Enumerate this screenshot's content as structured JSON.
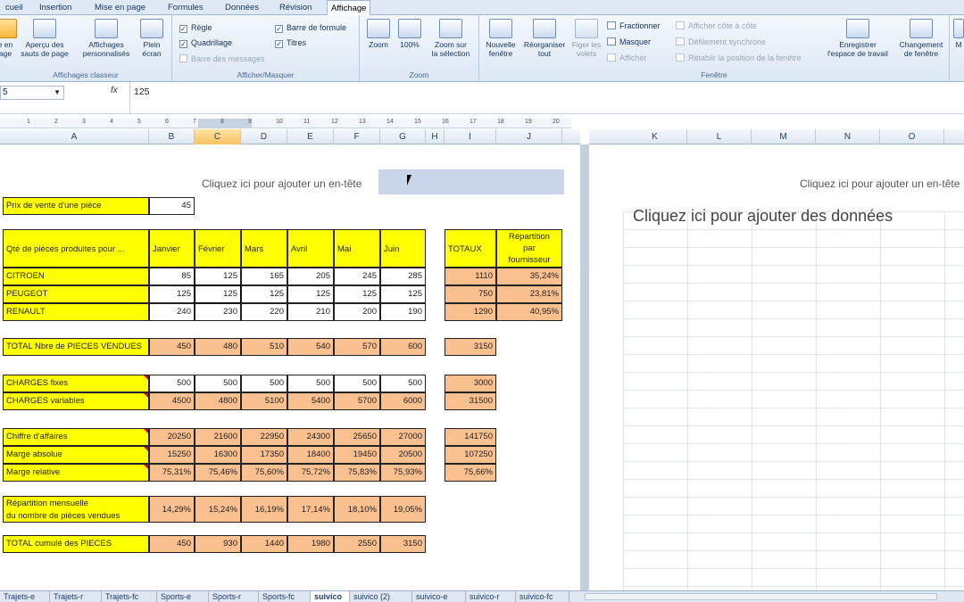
{
  "ribbon_tabs": [
    "cueil",
    "Insertion",
    "Mise en page",
    "Formules",
    "Données",
    "Révision",
    "Affichage"
  ],
  "active_tab": "Affichage",
  "ribbon": {
    "classeur": {
      "label": "Affichages classeur",
      "btn_normal": "e en\nage",
      "btn_apercu": "Aperçu des\nsauts de page",
      "btn_perso": "Affichages\npersonnalisés",
      "btn_plein": "Plein\nécran"
    },
    "masquer": {
      "label": "Afficher/Masquer",
      "regle": "Règle",
      "quadrillage": "Quadrillage",
      "barre_messages": "Barre des messages",
      "barre_formule": "Barre de formule",
      "titres": "Titres"
    },
    "zoom": {
      "label": "Zoom",
      "zoom": "Zoom",
      "cent": "100%",
      "selection": "Zoom sur\nla sélection"
    },
    "fenetre": {
      "label": "Fenêtre",
      "nouvelle": "Nouvelle\nfenêtre",
      "reorganiser": "Réorganiser\ntout",
      "figer": "Figer les\nvolets",
      "fractionner": "Fractionner",
      "masquer": "Masquer",
      "afficher": "Afficher",
      "cote": "Afficher côte à côte",
      "defilement": "Défilement synchrone",
      "retablir": "Rétablir la position de la fenêtre",
      "enregistrer": "Enregistrer\nl'espace de travail",
      "changement": "Changement\nde fenêtre"
    },
    "macros": "M"
  },
  "formula_bar": {
    "name_box": "5",
    "fx": "fx",
    "value": "125"
  },
  "ruler_labels": [
    "1",
    "2",
    "3",
    "4",
    "5",
    "6",
    "7",
    "8",
    "9",
    "10",
    "11",
    "12",
    "13",
    "14",
    "15",
    "16",
    "17",
    "18",
    "19",
    "20"
  ],
  "columns_left": [
    "A",
    "B",
    "C",
    "D",
    "E",
    "F",
    "G",
    "H",
    "I",
    "J"
  ],
  "columns_right": [
    "K",
    "L",
    "M",
    "N",
    "O"
  ],
  "header_hint": "Cliquez ici pour ajouter un en-tête",
  "data_hint": "Cliquez ici pour ajouter des données",
  "sheet": {
    "prix_label": "Prix de vente d'une pièce",
    "prix_value": "45",
    "qte_label": "Qté de pièces produites pour ...",
    "months": [
      "Janvier",
      "Février",
      "Mars",
      "Avril",
      "Mai",
      "Juin"
    ],
    "totaux_label": "TOTAUX",
    "repartition_label": "Répartition\npar\nfournisseur",
    "rows": [
      {
        "label": "CITROEN",
        "values": [
          "85",
          "125",
          "165",
          "205",
          "245",
          "285"
        ],
        "total": "1110",
        "rep": "35,24%"
      },
      {
        "label": "PEUGEOT",
        "values": [
          "125",
          "125",
          "125",
          "125",
          "125",
          "125"
        ],
        "total": "750",
        "rep": "23,81%"
      },
      {
        "label": "RENAULT",
        "values": [
          "240",
          "230",
          "220",
          "210",
          "200",
          "190"
        ],
        "total": "1290",
        "rep": "40,95%"
      }
    ],
    "total_pieces": {
      "label": "TOTAL Nbre de PIECES VENDUES",
      "values": [
        "450",
        "480",
        "510",
        "540",
        "570",
        "600"
      ],
      "total": "3150"
    },
    "charges_fixes": {
      "label": "CHARGES fixes",
      "values": [
        "500",
        "500",
        "500",
        "500",
        "500",
        "500"
      ],
      "total": "3000"
    },
    "charges_variables": {
      "label": "CHARGES variables",
      "values": [
        "4500",
        "4800",
        "5100",
        "5400",
        "5700",
        "6000"
      ],
      "total": "31500"
    },
    "chiffre_affaires": {
      "label": "Chiffre d'affaires",
      "values": [
        "20250",
        "21600",
        "22950",
        "24300",
        "25650",
        "27000"
      ],
      "total": "141750"
    },
    "marge_absolue": {
      "label": "Marge absolue",
      "values": [
        "15250",
        "16300",
        "17350",
        "18400",
        "19450",
        "20500"
      ],
      "total": "107250"
    },
    "marge_relative": {
      "label": "Marge relative",
      "values": [
        "75,31%",
        "75,46%",
        "75,60%",
        "75,72%",
        "75,83%",
        "75,93%"
      ],
      "total": "75,66%"
    },
    "repartition_mensuelle": {
      "label": "Répartition mensuelle\ndu nombre de pièces vendues",
      "values": [
        "14,29%",
        "15,24%",
        "16,19%",
        "17,14%",
        "18,10%",
        "19,05%"
      ]
    },
    "total_cumule": {
      "label": "TOTAL cumulé des PIECES",
      "values": [
        "450",
        "930",
        "1440",
        "1980",
        "2550",
        "3150"
      ]
    }
  },
  "sheet_tabs": [
    "Trajets-e",
    "Trajets-r",
    "Trajets-fc",
    "Sports-e",
    "Sports-r",
    "Sports-fc",
    "suivico",
    "suivico (2)",
    "suivico-e",
    "suivico-r",
    "suivico-fc"
  ],
  "active_sheet": "suivico",
  "colors": {
    "yellow": "#ffff00",
    "orange": "#fac090",
    "ribbon": "#dce7f5"
  }
}
